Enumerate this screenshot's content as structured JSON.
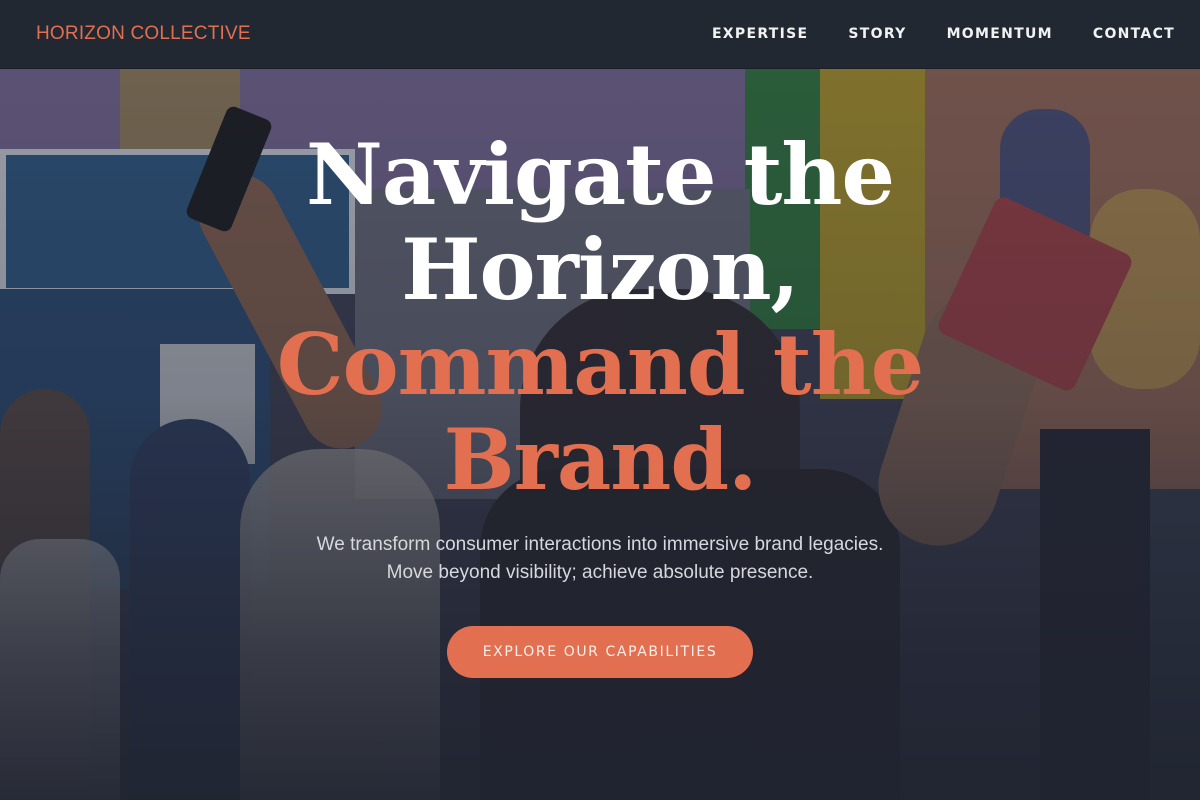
{
  "brand": {
    "name": "HORIZON COLLECTIVE"
  },
  "nav": {
    "items": [
      {
        "label": "EXPERTISE"
      },
      {
        "label": "STORY"
      },
      {
        "label": "MOMENTUM"
      },
      {
        "label": "CONTACT"
      }
    ]
  },
  "hero": {
    "headline_line1": "Navigate the",
    "headline_line2": "Horizon,",
    "headline_line3": "Command the",
    "headline_line4": "Brand.",
    "subtext_line1": "We transform consumer interactions into immersive brand legacies.",
    "subtext_line2": "Move beyond visibility; achieve absolute presence.",
    "cta_label": "EXPLORE OUR CAPABILITIES"
  },
  "colors": {
    "accent": "#e36f51",
    "navbar_bg": "#222831",
    "headline_text": "#ffffff",
    "subtext": "#d6d8de"
  }
}
